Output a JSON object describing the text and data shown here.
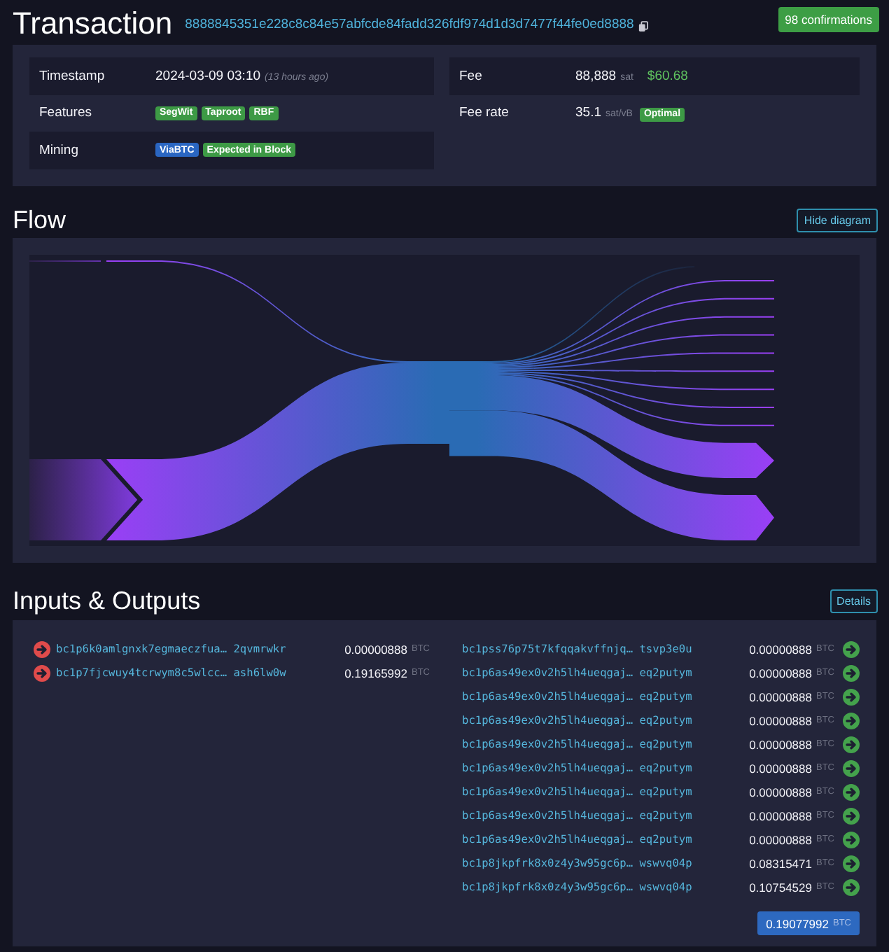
{
  "header": {
    "title": "Transaction",
    "txid": "8888845351e228c8c84e57abfcde84fadd326fdf974d1d3d7477f44fe0ed8888",
    "confirmations": "98 confirmations"
  },
  "details": {
    "left": [
      {
        "label": "Timestamp",
        "value": "2024-03-09 03:10",
        "note": "(13 hours ago)"
      },
      {
        "label": "Features",
        "badges": [
          {
            "text": "SegWit",
            "color": "#3d9a45"
          },
          {
            "text": "Taproot",
            "color": "#3d9a45"
          },
          {
            "text": "RBF",
            "color": "#3d9a45"
          }
        ]
      },
      {
        "label": "Mining",
        "badges": [
          {
            "text": "ViaBTC",
            "color": "#2a66c2"
          },
          {
            "text": "Expected in Block",
            "color": "#3d9a45"
          }
        ]
      }
    ],
    "right": [
      {
        "label": "Fee",
        "value": "88,888",
        "unit": "sat",
        "fiat": "$60.68"
      },
      {
        "label": "Fee rate",
        "value": "35.1",
        "unit": "sat/vB",
        "badges": [
          {
            "text": "Optimal",
            "color": "#3d9a45"
          }
        ]
      }
    ]
  },
  "flow": {
    "title": "Flow",
    "button": "Hide diagram"
  },
  "io": {
    "title": "Inputs & Outputs",
    "button": "Details",
    "inputs": [
      {
        "address": "bc1p6k0amlgnxk7egmaeczfua… 2qvmrwkr",
        "amount": "0.00000888",
        "unit": "BTC"
      },
      {
        "address": "bc1p7fjcwuy4tcrwym8c5wlcc… ash6lw0w",
        "amount": "0.19165992",
        "unit": "BTC"
      }
    ],
    "outputs": [
      {
        "address": "bc1pss76p75t7kfqqakvffnjq… tsvp3e0u",
        "amount": "0.00000888",
        "unit": "BTC"
      },
      {
        "address": "bc1p6as49ex0v2h5lh4ueqgaj… eq2putym",
        "amount": "0.00000888",
        "unit": "BTC"
      },
      {
        "address": "bc1p6as49ex0v2h5lh4ueqgaj… eq2putym",
        "amount": "0.00000888",
        "unit": "BTC"
      },
      {
        "address": "bc1p6as49ex0v2h5lh4ueqgaj… eq2putym",
        "amount": "0.00000888",
        "unit": "BTC"
      },
      {
        "address": "bc1p6as49ex0v2h5lh4ueqgaj… eq2putym",
        "amount": "0.00000888",
        "unit": "BTC"
      },
      {
        "address": "bc1p6as49ex0v2h5lh4ueqgaj… eq2putym",
        "amount": "0.00000888",
        "unit": "BTC"
      },
      {
        "address": "bc1p6as49ex0v2h5lh4ueqgaj… eq2putym",
        "amount": "0.00000888",
        "unit": "BTC"
      },
      {
        "address": "bc1p6as49ex0v2h5lh4ueqgaj… eq2putym",
        "amount": "0.00000888",
        "unit": "BTC"
      },
      {
        "address": "bc1p6as49ex0v2h5lh4ueqgaj… eq2putym",
        "amount": "0.00000888",
        "unit": "BTC"
      },
      {
        "address": "bc1p8jkpfrk8x0z4y3w95gc6p… wswvq04p",
        "amount": "0.08315471",
        "unit": "BTC"
      },
      {
        "address": "bc1p8jkpfrk8x0z4y3w95gc6p… wswvq04p",
        "amount": "0.10754529",
        "unit": "BTC"
      }
    ],
    "total": {
      "amount": "0.19077992",
      "unit": "BTC"
    }
  }
}
